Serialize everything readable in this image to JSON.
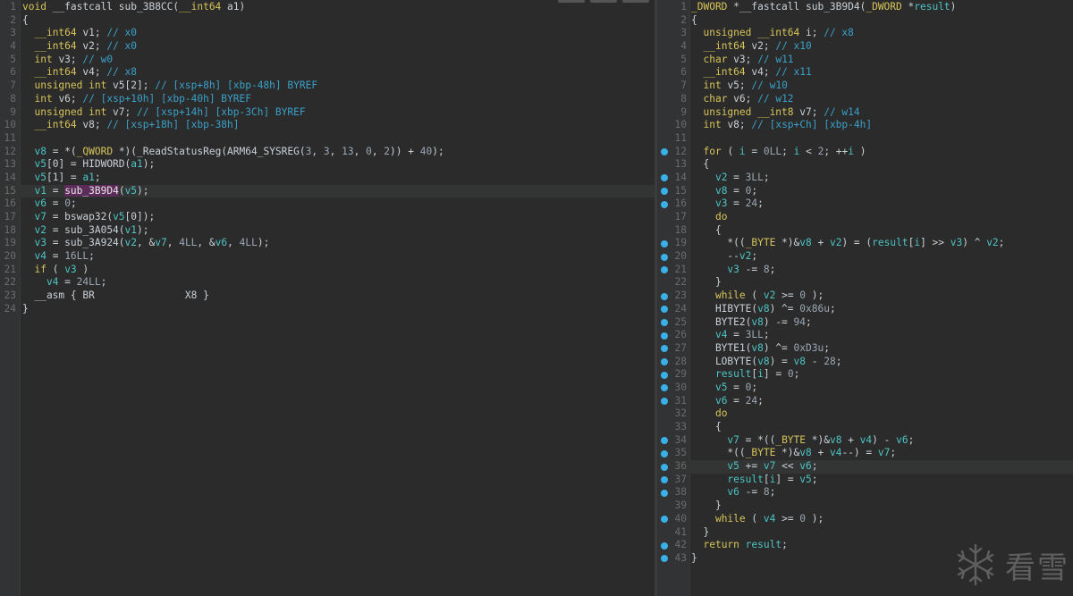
{
  "left_code": [
    [
      [
        "kw",
        "void"
      ],
      [
        "pl",
        " __fastcall sub_3B8CC("
      ],
      [
        "kw",
        "__int64"
      ],
      [
        "pl",
        " a1)"
      ]
    ],
    [
      [
        "pl",
        "{"
      ]
    ],
    [
      [
        "pl",
        "  "
      ],
      [
        "kw",
        "__int64"
      ],
      [
        "pl",
        " v1; "
      ],
      [
        "cm",
        "// x0"
      ]
    ],
    [
      [
        "pl",
        "  "
      ],
      [
        "kw",
        "__int64"
      ],
      [
        "pl",
        " v2; "
      ],
      [
        "cm",
        "// x0"
      ]
    ],
    [
      [
        "pl",
        "  "
      ],
      [
        "kw",
        "int"
      ],
      [
        "pl",
        " v3; "
      ],
      [
        "cm",
        "// w0"
      ]
    ],
    [
      [
        "pl",
        "  "
      ],
      [
        "kw",
        "__int64"
      ],
      [
        "pl",
        " v4; "
      ],
      [
        "cm",
        "// x8"
      ]
    ],
    [
      [
        "pl",
        "  "
      ],
      [
        "kw",
        "unsigned int"
      ],
      [
        "pl",
        " v5[2]; "
      ],
      [
        "cm",
        "// [xsp+8h] [xbp-48h] BYREF"
      ]
    ],
    [
      [
        "pl",
        "  "
      ],
      [
        "kw",
        "int"
      ],
      [
        "pl",
        " v6; "
      ],
      [
        "cm",
        "// [xsp+10h] [xbp-40h] BYREF"
      ]
    ],
    [
      [
        "pl",
        "  "
      ],
      [
        "kw",
        "unsigned int"
      ],
      [
        "pl",
        " v7; "
      ],
      [
        "cm",
        "// [xsp+14h] [xbp-3Ch] BYREF"
      ]
    ],
    [
      [
        "pl",
        "  "
      ],
      [
        "kw",
        "__int64"
      ],
      [
        "pl",
        " v8; "
      ],
      [
        "cm",
        "// [xsp+18h] [xbp-38h]"
      ]
    ],
    [],
    [
      [
        "pl",
        "  "
      ],
      [
        "var",
        "v8"
      ],
      [
        "pl",
        " = *("
      ],
      [
        "kw",
        "_QWORD"
      ],
      [
        "pl",
        " *)(_ReadStatusReg(ARM64_SYSREG("
      ],
      [
        "num",
        "3"
      ],
      [
        "pl",
        ", "
      ],
      [
        "num",
        "3"
      ],
      [
        "pl",
        ", "
      ],
      [
        "num",
        "13"
      ],
      [
        "pl",
        ", "
      ],
      [
        "num",
        "0"
      ],
      [
        "pl",
        ", "
      ],
      [
        "num",
        "2"
      ],
      [
        "pl",
        ")) + "
      ],
      [
        "num",
        "40"
      ],
      [
        "pl",
        ");"
      ]
    ],
    [
      [
        "pl",
        "  "
      ],
      [
        "var",
        "v5"
      ],
      [
        "pl",
        "[0] = HIDWORD("
      ],
      [
        "var",
        "a1"
      ],
      [
        "pl",
        ");"
      ]
    ],
    [
      [
        "pl",
        "  "
      ],
      [
        "var",
        "v5"
      ],
      [
        "pl",
        "[1] = "
      ],
      [
        "var",
        "a1"
      ],
      [
        "pl",
        ";"
      ]
    ],
    [
      [
        "pl",
        "  "
      ],
      [
        "var",
        "v1"
      ],
      [
        "pl",
        " = "
      ],
      [
        "hlfn",
        "sub_3B9D4"
      ],
      [
        "pl",
        "("
      ],
      [
        "var",
        "v5"
      ],
      [
        "pl",
        ");"
      ]
    ],
    [
      [
        "pl",
        "  "
      ],
      [
        "var",
        "v6"
      ],
      [
        "pl",
        " = "
      ],
      [
        "num",
        "0"
      ],
      [
        "pl",
        ";"
      ]
    ],
    [
      [
        "pl",
        "  "
      ],
      [
        "var",
        "v7"
      ],
      [
        "pl",
        " = bswap32("
      ],
      [
        "var",
        "v5"
      ],
      [
        "pl",
        "[0]);"
      ]
    ],
    [
      [
        "pl",
        "  "
      ],
      [
        "var",
        "v2"
      ],
      [
        "pl",
        " = sub_3A054("
      ],
      [
        "var",
        "v1"
      ],
      [
        "pl",
        ");"
      ]
    ],
    [
      [
        "pl",
        "  "
      ],
      [
        "var",
        "v3"
      ],
      [
        "pl",
        " = sub_3A924("
      ],
      [
        "var",
        "v2"
      ],
      [
        "pl",
        ", &"
      ],
      [
        "var",
        "v7"
      ],
      [
        "pl",
        ", "
      ],
      [
        "num",
        "4LL"
      ],
      [
        "pl",
        ", &"
      ],
      [
        "var",
        "v6"
      ],
      [
        "pl",
        ", "
      ],
      [
        "num",
        "4LL"
      ],
      [
        "pl",
        ");"
      ]
    ],
    [
      [
        "pl",
        "  "
      ],
      [
        "var",
        "v4"
      ],
      [
        "pl",
        " = "
      ],
      [
        "num",
        "16LL"
      ],
      [
        "pl",
        ";"
      ]
    ],
    [
      [
        "pl",
        "  "
      ],
      [
        "kw",
        "if"
      ],
      [
        "pl",
        " ( "
      ],
      [
        "var",
        "v3"
      ],
      [
        "pl",
        " )"
      ]
    ],
    [
      [
        "pl",
        "    "
      ],
      [
        "var",
        "v4"
      ],
      [
        "pl",
        " = "
      ],
      [
        "num",
        "24LL"
      ],
      [
        "pl",
        ";"
      ]
    ],
    [
      [
        "pl",
        "  __asm { BR               X8 }"
      ]
    ],
    [
      [
        "pl",
        "}"
      ]
    ]
  ],
  "left_highlight_line": 15,
  "right_code": [
    [
      [
        "kw",
        "_DWORD"
      ],
      [
        "pl",
        " *__fastcall sub_3B9D4("
      ],
      [
        "kw",
        "_DWORD"
      ],
      [
        "pl",
        " *"
      ],
      [
        "var",
        "result"
      ],
      [
        "pl",
        ")"
      ]
    ],
    [
      [
        "pl",
        "{"
      ]
    ],
    [
      [
        "pl",
        "  "
      ],
      [
        "kw",
        "unsigned __int64"
      ],
      [
        "pl",
        " i; "
      ],
      [
        "cm",
        "// x8"
      ]
    ],
    [
      [
        "pl",
        "  "
      ],
      [
        "kw",
        "__int64"
      ],
      [
        "pl",
        " v2; "
      ],
      [
        "cm",
        "// x10"
      ]
    ],
    [
      [
        "pl",
        "  "
      ],
      [
        "kw",
        "char"
      ],
      [
        "pl",
        " v3; "
      ],
      [
        "cm",
        "// w11"
      ]
    ],
    [
      [
        "pl",
        "  "
      ],
      [
        "kw",
        "__int64"
      ],
      [
        "pl",
        " v4; "
      ],
      [
        "cm",
        "// x11"
      ]
    ],
    [
      [
        "pl",
        "  "
      ],
      [
        "kw",
        "int"
      ],
      [
        "pl",
        " v5; "
      ],
      [
        "cm",
        "// w10"
      ]
    ],
    [
      [
        "pl",
        "  "
      ],
      [
        "kw",
        "char"
      ],
      [
        "pl",
        " v6; "
      ],
      [
        "cm",
        "// w12"
      ]
    ],
    [
      [
        "pl",
        "  "
      ],
      [
        "kw",
        "unsigned __int8"
      ],
      [
        "pl",
        " v7; "
      ],
      [
        "cm",
        "// w14"
      ]
    ],
    [
      [
        "pl",
        "  "
      ],
      [
        "kw",
        "int"
      ],
      [
        "pl",
        " v8; "
      ],
      [
        "cm",
        "// [xsp+Ch] [xbp-4h]"
      ]
    ],
    [],
    [
      [
        "pl",
        "  "
      ],
      [
        "kw",
        "for"
      ],
      [
        "pl",
        " ( "
      ],
      [
        "var",
        "i"
      ],
      [
        "pl",
        " = "
      ],
      [
        "num",
        "0LL"
      ],
      [
        "pl",
        "; "
      ],
      [
        "var",
        "i"
      ],
      [
        "pl",
        " < "
      ],
      [
        "num",
        "2"
      ],
      [
        "pl",
        "; ++"
      ],
      [
        "var",
        "i"
      ],
      [
        "pl",
        " )"
      ]
    ],
    [
      [
        "pl",
        "  {"
      ]
    ],
    [
      [
        "pl",
        "    "
      ],
      [
        "var",
        "v2"
      ],
      [
        "pl",
        " = "
      ],
      [
        "num",
        "3LL"
      ],
      [
        "pl",
        ";"
      ]
    ],
    [
      [
        "pl",
        "    "
      ],
      [
        "var",
        "v8"
      ],
      [
        "pl",
        " = "
      ],
      [
        "num",
        "0"
      ],
      [
        "pl",
        ";"
      ]
    ],
    [
      [
        "pl",
        "    "
      ],
      [
        "var",
        "v3"
      ],
      [
        "pl",
        " = "
      ],
      [
        "num",
        "24"
      ],
      [
        "pl",
        ";"
      ]
    ],
    [
      [
        "pl",
        "    "
      ],
      [
        "kw",
        "do"
      ]
    ],
    [
      [
        "pl",
        "    {"
      ]
    ],
    [
      [
        "pl",
        "      *(("
      ],
      [
        "kw",
        "_BYTE"
      ],
      [
        "pl",
        " *)&"
      ],
      [
        "var",
        "v8"
      ],
      [
        "pl",
        " + "
      ],
      [
        "var",
        "v2"
      ],
      [
        "pl",
        ") = ("
      ],
      [
        "var",
        "result"
      ],
      [
        "pl",
        "["
      ],
      [
        "var",
        "i"
      ],
      [
        "pl",
        "] >> "
      ],
      [
        "var",
        "v3"
      ],
      [
        "pl",
        ") ^ "
      ],
      [
        "var",
        "v2"
      ],
      [
        "pl",
        ";"
      ]
    ],
    [
      [
        "pl",
        "      --"
      ],
      [
        "var",
        "v2"
      ],
      [
        "pl",
        ";"
      ]
    ],
    [
      [
        "pl",
        "      "
      ],
      [
        "var",
        "v3"
      ],
      [
        "pl",
        " -= "
      ],
      [
        "num",
        "8"
      ],
      [
        "pl",
        ";"
      ]
    ],
    [
      [
        "pl",
        "    }"
      ]
    ],
    [
      [
        "pl",
        "    "
      ],
      [
        "kw",
        "while"
      ],
      [
        "pl",
        " ( "
      ],
      [
        "var",
        "v2"
      ],
      [
        "pl",
        " >= "
      ],
      [
        "num",
        "0"
      ],
      [
        "pl",
        " );"
      ]
    ],
    [
      [
        "pl",
        "    HIBYTE("
      ],
      [
        "var",
        "v8"
      ],
      [
        "pl",
        ") ^= "
      ],
      [
        "num",
        "0x86u"
      ],
      [
        "pl",
        ";"
      ]
    ],
    [
      [
        "pl",
        "    BYTE2("
      ],
      [
        "var",
        "v8"
      ],
      [
        "pl",
        ") -= "
      ],
      [
        "num",
        "94"
      ],
      [
        "pl",
        ";"
      ]
    ],
    [
      [
        "pl",
        "    "
      ],
      [
        "var",
        "v4"
      ],
      [
        "pl",
        " = "
      ],
      [
        "num",
        "3LL"
      ],
      [
        "pl",
        ";"
      ]
    ],
    [
      [
        "pl",
        "    BYTE1("
      ],
      [
        "var",
        "v8"
      ],
      [
        "pl",
        ") ^= "
      ],
      [
        "num",
        "0xD3u"
      ],
      [
        "pl",
        ";"
      ]
    ],
    [
      [
        "pl",
        "    LOBYTE("
      ],
      [
        "var",
        "v8"
      ],
      [
        "pl",
        ") = "
      ],
      [
        "var",
        "v8"
      ],
      [
        "pl",
        " - "
      ],
      [
        "num",
        "28"
      ],
      [
        "pl",
        ";"
      ]
    ],
    [
      [
        "pl",
        "    "
      ],
      [
        "var",
        "result"
      ],
      [
        "pl",
        "["
      ],
      [
        "var",
        "i"
      ],
      [
        "pl",
        "] = "
      ],
      [
        "num",
        "0"
      ],
      [
        "pl",
        ";"
      ]
    ],
    [
      [
        "pl",
        "    "
      ],
      [
        "var",
        "v5"
      ],
      [
        "pl",
        " = "
      ],
      [
        "num",
        "0"
      ],
      [
        "pl",
        ";"
      ]
    ],
    [
      [
        "pl",
        "    "
      ],
      [
        "var",
        "v6"
      ],
      [
        "pl",
        " = "
      ],
      [
        "num",
        "24"
      ],
      [
        "pl",
        ";"
      ]
    ],
    [
      [
        "pl",
        "    "
      ],
      [
        "kw",
        "do"
      ]
    ],
    [
      [
        "pl",
        "    {"
      ]
    ],
    [
      [
        "pl",
        "      "
      ],
      [
        "var",
        "v7"
      ],
      [
        "pl",
        " = *(("
      ],
      [
        "kw",
        "_BYTE"
      ],
      [
        "pl",
        " *)&"
      ],
      [
        "var",
        "v8"
      ],
      [
        "pl",
        " + "
      ],
      [
        "var",
        "v4"
      ],
      [
        "pl",
        ") - "
      ],
      [
        "var",
        "v6"
      ],
      [
        "pl",
        ";"
      ]
    ],
    [
      [
        "pl",
        "      *(("
      ],
      [
        "kw",
        "_BYTE"
      ],
      [
        "pl",
        " *)&"
      ],
      [
        "var",
        "v8"
      ],
      [
        "pl",
        " + "
      ],
      [
        "var",
        "v4"
      ],
      [
        "pl",
        "--) = "
      ],
      [
        "var",
        "v7"
      ],
      [
        "pl",
        ";"
      ]
    ],
    [
      [
        "pl",
        "      "
      ],
      [
        "var",
        "v5"
      ],
      [
        "pl",
        " += "
      ],
      [
        "var",
        "v7"
      ],
      [
        "pl",
        " << "
      ],
      [
        "var",
        "v6"
      ],
      [
        "pl",
        ";"
      ]
    ],
    [
      [
        "pl",
        "      "
      ],
      [
        "var",
        "result"
      ],
      [
        "pl",
        "["
      ],
      [
        "var",
        "i"
      ],
      [
        "pl",
        "] = "
      ],
      [
        "var",
        "v5"
      ],
      [
        "pl",
        ";"
      ]
    ],
    [
      [
        "pl",
        "      "
      ],
      [
        "var",
        "v6"
      ],
      [
        "pl",
        " -= "
      ],
      [
        "num",
        "8"
      ],
      [
        "pl",
        ";"
      ]
    ],
    [
      [
        "pl",
        "    }"
      ]
    ],
    [
      [
        "pl",
        "    "
      ],
      [
        "kw",
        "while"
      ],
      [
        "pl",
        " ( "
      ],
      [
        "var",
        "v4"
      ],
      [
        "pl",
        " >= "
      ],
      [
        "num",
        "0"
      ],
      [
        "pl",
        " );"
      ]
    ],
    [
      [
        "pl",
        "  }"
      ]
    ],
    [
      [
        "pl",
        "  "
      ],
      [
        "kw",
        "return"
      ],
      [
        "pl",
        " "
      ],
      [
        "var",
        "result"
      ],
      [
        "pl",
        ";"
      ]
    ],
    [
      [
        "pl",
        "}"
      ]
    ]
  ],
  "right_highlight_line": 36,
  "right_breakpoints": [
    12,
    14,
    15,
    16,
    19,
    20,
    21,
    23,
    24,
    25,
    26,
    27,
    28,
    29,
    30,
    31,
    34,
    35,
    36,
    37,
    38,
    40,
    42,
    43
  ],
  "watermark": {
    "icon": "snowflake-icon",
    "text": "看雪"
  },
  "colors": {
    "background": "#2b2b2b",
    "keyword": "#d7c45a",
    "variable": "#4cc4c4",
    "comment": "#3aa0c8",
    "breakpoint": "#3ab0e6",
    "highlighted_function": "#5c2b5a"
  }
}
